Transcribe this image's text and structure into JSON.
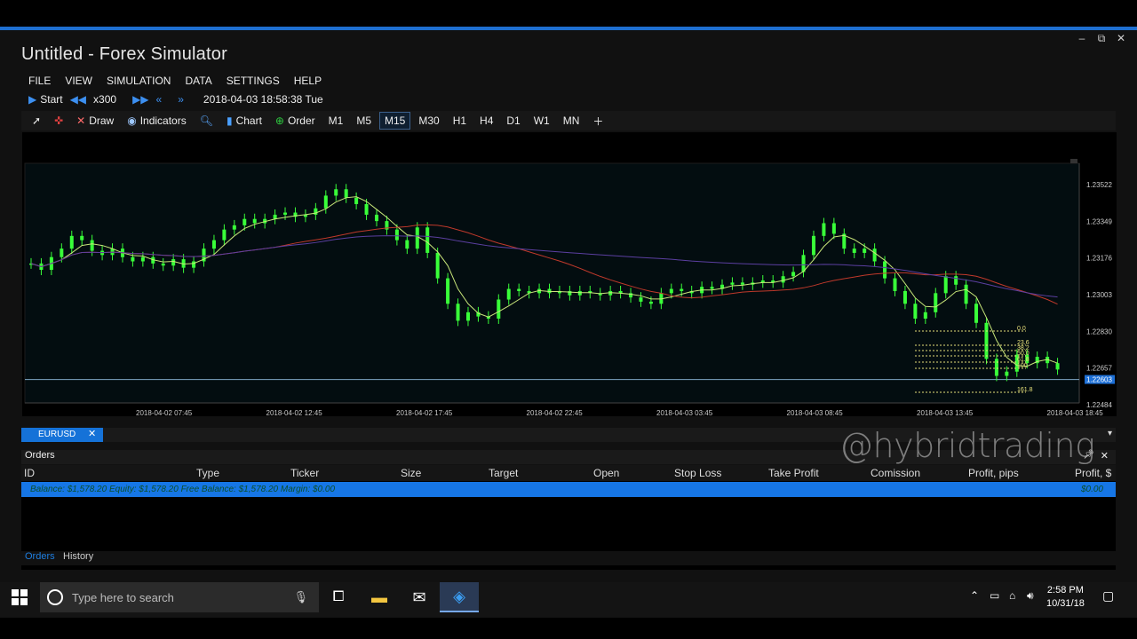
{
  "window": {
    "title": "Untitled - Forex Simulator",
    "controls": [
      "‒",
      "⧉",
      "✕"
    ]
  },
  "menu": [
    "FILE",
    "VIEW",
    "SIMULATION",
    "DATA",
    "SETTINGS",
    "HELP"
  ],
  "runbar": {
    "start": "Start",
    "speed": "x300",
    "datetime": "2018-04-03 18:58:38 Tue"
  },
  "toolbar": {
    "draw": "Draw",
    "indicators": "Indicators",
    "chart": "Chart",
    "order": "Order",
    "timeframes": [
      "M1",
      "M5",
      "M15",
      "M30",
      "H1",
      "H4",
      "D1",
      "W1",
      "MN"
    ],
    "selected_timeframe": "M15"
  },
  "chart_data": {
    "type": "candlestick",
    "symbol": "EURUSD",
    "price_ticks": [
      "1.23522",
      "1.23349",
      "1.23176",
      "1.23003",
      "1.22830",
      "1.22657",
      "1.22484"
    ],
    "current_price": "1.22603",
    "time_ticks": [
      "2018-04-02 07:45",
      "2018-04-02 12:45",
      "2018-04-02 17:45",
      "2018-04-02 22:45",
      "2018-04-03 03:45",
      "2018-04-03 08:45",
      "2018-04-03 13:45",
      "2018-04-03 18:45"
    ],
    "fib_levels": [
      "0.0",
      "23.6",
      "38.2",
      "50.0",
      "61.8",
      "100",
      "161.8"
    ],
    "close": [
      1.2315,
      1.2312,
      1.2318,
      1.2322,
      1.2328,
      1.2326,
      1.2321,
      1.2319,
      1.2322,
      1.2318,
      1.2316,
      1.2318,
      1.2315,
      1.2314,
      1.2317,
      1.2313,
      1.2316,
      1.2322,
      1.2326,
      1.2331,
      1.2333,
      1.2336,
      1.2334,
      1.2336,
      1.2338,
      1.2339,
      1.2337,
      1.2338,
      1.2341,
      1.2347,
      1.235,
      1.2346,
      1.2343,
      1.2338,
      1.2335,
      1.2331,
      1.2326,
      1.2322,
      1.2332,
      1.232,
      1.2308,
      1.2296,
      1.2288,
      1.2292,
      1.229,
      1.2289,
      1.2298,
      1.2303,
      1.2302,
      1.2301,
      1.2303,
      1.2301,
      1.2302,
      1.23,
      1.2302,
      1.2301,
      1.23,
      1.2302,
      1.2301,
      1.2299,
      1.2297,
      1.2296,
      1.2301,
      1.2303,
      1.2302,
      1.2301,
      1.2304,
      1.2303,
      1.2305,
      1.2306,
      1.2305,
      1.2306,
      1.2307,
      1.2306,
      1.2309,
      1.2311,
      1.2319,
      1.2328,
      1.2334,
      1.2329,
      1.2322,
      1.232,
      1.2322,
      1.2316,
      1.2308,
      1.2302,
      1.2296,
      1.2289,
      1.2292,
      1.2301,
      1.2309,
      1.2305,
      1.2296,
      1.2287,
      1.227,
      1.2262,
      1.2264,
      1.2272,
      1.2268,
      1.2271,
      1.2268,
      1.2265
    ]
  },
  "symbol_tab": {
    "label": "EURUSD",
    "close": "✕",
    "dropdown": "▾"
  },
  "orders_panel": {
    "title": "Orders",
    "columns": [
      "ID",
      "Type",
      "Ticker",
      "Size",
      "Target",
      "Open",
      "Stop Loss",
      "Take Profit",
      "Comission",
      "Profit, pips",
      "Profit, $"
    ],
    "balance_line": "Balance: $1,578.20 Equity: $1,578.20 Free Balance: $1,578.20 Margin: $0.00",
    "profit_total": "$0.00",
    "tabs": [
      "Orders",
      "History"
    ]
  },
  "watermark": "@hybridtrading",
  "taskbar": {
    "search_placeholder": "Type here to search",
    "time": "2:58 PM",
    "date": "10/31/18"
  },
  "colors": {
    "accent": "#1e6fd0",
    "candle": "#39ff39",
    "ma_fast": "#c8e67a",
    "ma_slow": "#c0392b",
    "ma_long": "#5b3fa0",
    "selected_row": "#1676e6"
  }
}
